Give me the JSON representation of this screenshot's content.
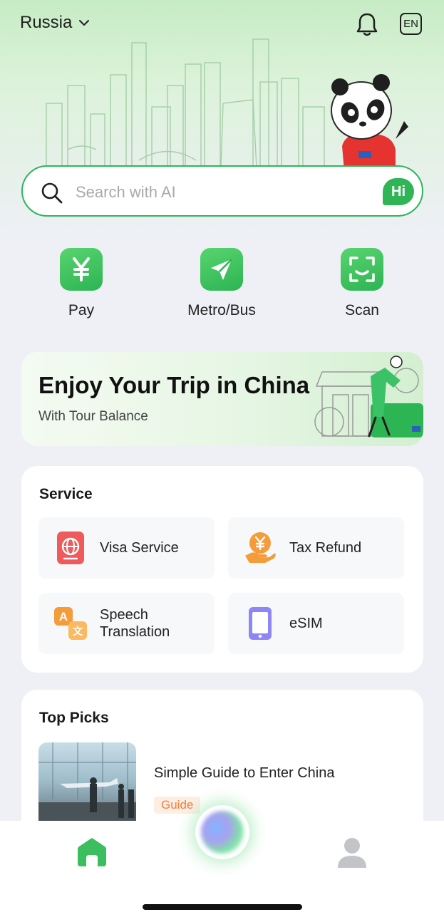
{
  "header": {
    "country": "Russia",
    "language": "EN",
    "icons": [
      "chevron-down-icon",
      "bell-icon"
    ]
  },
  "search": {
    "placeholder": "Search with AI",
    "ai_badge": "Hi"
  },
  "quick_actions": [
    {
      "label": "Pay",
      "icon": "yuan-icon"
    },
    {
      "label": "Metro/Bus",
      "icon": "navigation-arrow-icon"
    },
    {
      "label": "Scan",
      "icon": "scan-icon"
    }
  ],
  "banner": {
    "title": "Enjoy Your Trip in China",
    "subtitle": "With Tour Balance"
  },
  "service": {
    "title": "Service",
    "items": [
      {
        "label": "Visa Service",
        "icon": "passport-globe-icon"
      },
      {
        "label": "Tax Refund",
        "icon": "yuan-hand-icon"
      },
      {
        "label": "Speech Translation",
        "icon": "translate-icon"
      },
      {
        "label": "eSIM",
        "icon": "phone-icon"
      }
    ]
  },
  "top_picks": {
    "title": "Top Picks",
    "items": [
      {
        "title": "Simple Guide to Enter China",
        "tag": "Guide"
      }
    ]
  },
  "colors": {
    "brand_green": "#2db453",
    "tag_orange": "#ef7d3a",
    "visa_red": "#ef5a5a",
    "tax_orange": "#f49b3a",
    "esim_purple": "#8e86f5"
  }
}
